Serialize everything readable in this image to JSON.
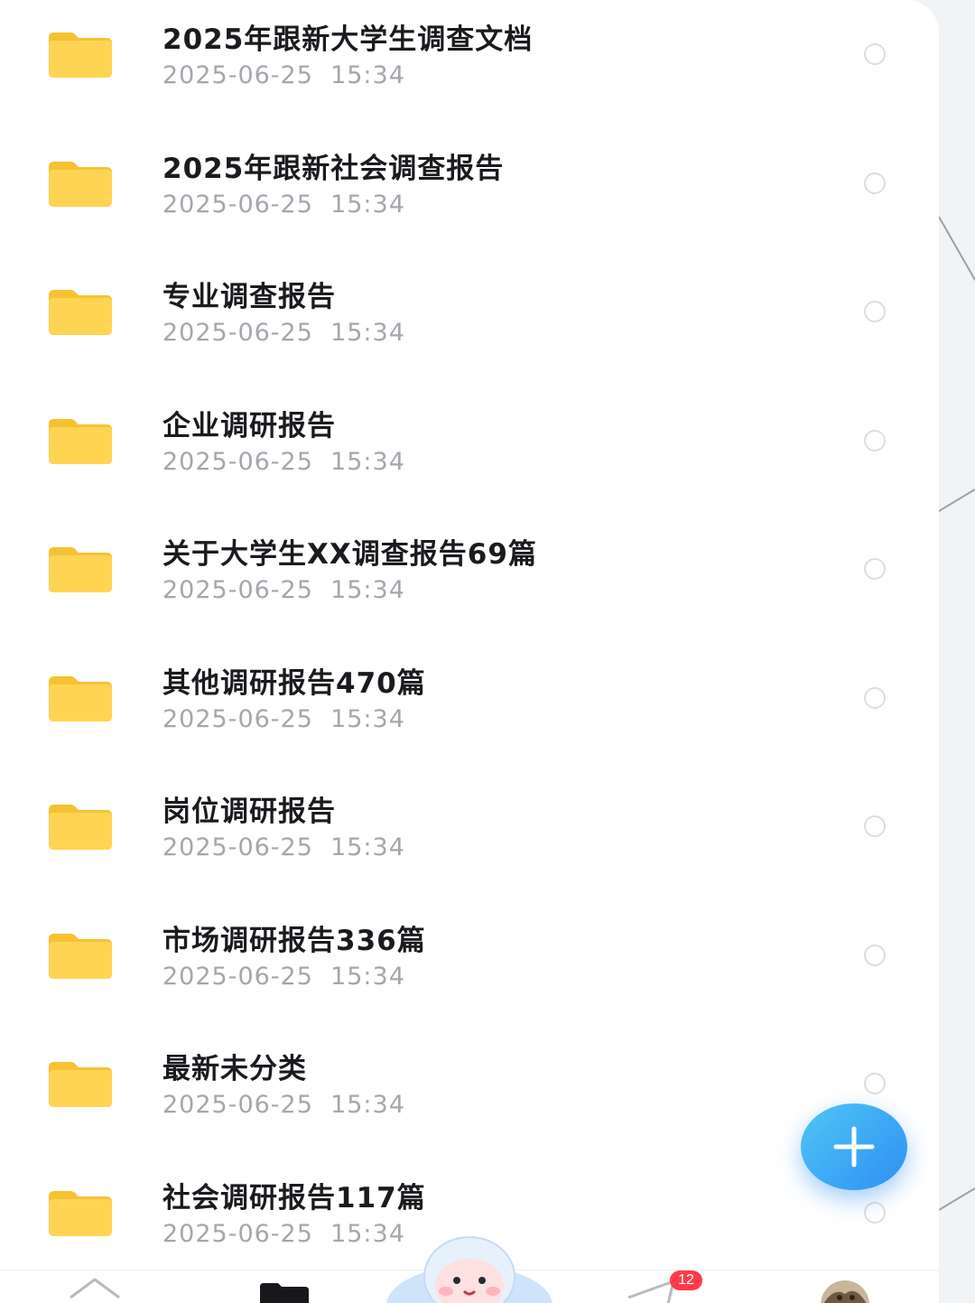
{
  "files": [
    {
      "name": "2025年跟新大学生调查文档",
      "time": "2025-06-25  15:34"
    },
    {
      "name": "2025年跟新社会调查报告",
      "time": "2025-06-25  15:34"
    },
    {
      "name": "专业调查报告",
      "time": "2025-06-25  15:34"
    },
    {
      "name": "企业调研报告",
      "time": "2025-06-25  15:34"
    },
    {
      "name": "关于大学生XX调查报告69篇",
      "time": "2025-06-25  15:34"
    },
    {
      "name": "其他调研报告470篇",
      "time": "2025-06-25  15:34"
    },
    {
      "name": "岗位调研报告",
      "time": "2025-06-25  15:34"
    },
    {
      "name": "市场调研报告336篇",
      "time": "2025-06-25  15:34"
    },
    {
      "name": "最新未分类",
      "time": "2025-06-25  15:34"
    },
    {
      "name": "社会调研报告117篇",
      "time": "2025-06-25  15:34"
    }
  ],
  "fab": {
    "icon": "plus-icon",
    "color": "#2f8ff2"
  },
  "tabbar": {
    "tabs": [
      {
        "icon": "home-icon"
      },
      {
        "icon": "folder-icon",
        "active": true
      },
      {
        "icon": "mascot-icon"
      },
      {
        "icon": "send-icon",
        "badge": "12"
      },
      {
        "icon": "avatar-icon"
      }
    ]
  },
  "colors": {
    "folder": "#ffd452",
    "title_text": "#1b1b1f",
    "time_text": "#a4a7ad",
    "badge": "#ff3b4a"
  }
}
